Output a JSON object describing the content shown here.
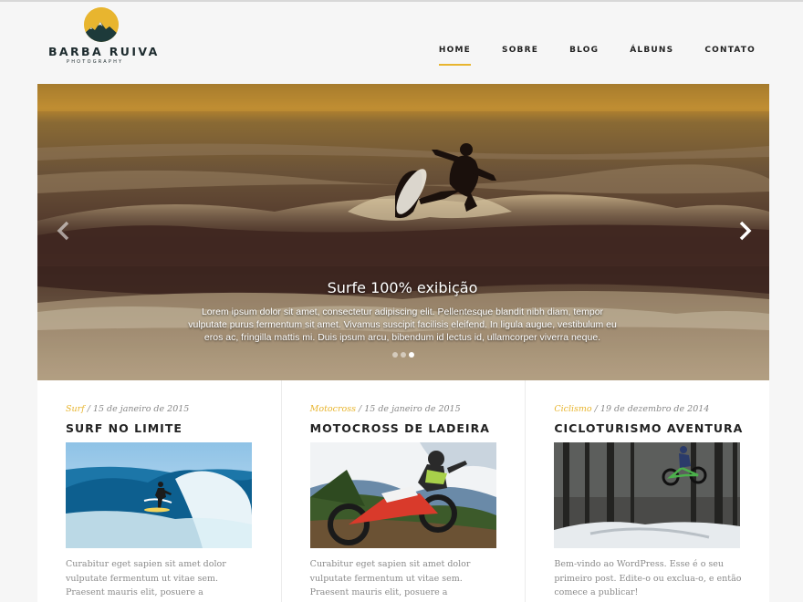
{
  "brand": {
    "name": "BARBA RUIVA",
    "tagline": "PHOTOGRAPHY",
    "accent": "#e8b52f"
  },
  "nav": {
    "items": [
      {
        "label": "HOME",
        "active": true
      },
      {
        "label": "SOBRE",
        "active": false
      },
      {
        "label": "BLOG",
        "active": false
      },
      {
        "label": "ÁLBUNS",
        "active": false
      },
      {
        "label": "CONTATO",
        "active": false
      }
    ]
  },
  "slider": {
    "title": "Surfe 100% exibição",
    "text": "Lorem ipsum dolor sit amet, consectetur adipiscing elit. Pellentesque blandit nibh diam, tempor vulputate purus fermentum sit amet. Vivamus suscipit facilisis eleifend. In ligula augue, vestibulum eu eros ac, fringilla mattis mi. Duis ipsum arcu, bibendum id lectus id, ullamcorper viverra neque.",
    "prev_icon": "chevron-left-icon",
    "next_icon": "chevron-right-icon",
    "slide_count": 3,
    "active_slide": 3
  },
  "posts": [
    {
      "category": "Surf",
      "date": " / 15 de janeiro de 2015",
      "title": "SURF NO LIMITE",
      "excerpt": "Curabitur eget sapien sit amet dolor vulputate fermentum ut vitae sem. Praesent mauris elit, posuere a ullamcorper non, varius quis ipsum."
    },
    {
      "category": "Motocross",
      "date": " / 15 de janeiro de 2015",
      "title": "MOTOCROSS DE LADEIRA",
      "excerpt": "Curabitur eget sapien sit amet dolor vulputate fermentum ut vitae sem. Praesent mauris elit, posuere a ullamcorper non, varius quis ipsum."
    },
    {
      "category": "Ciclismo",
      "date": " / 19 de dezembro de 2014",
      "title": "CICLOTURISMO AVENTURA",
      "excerpt": "Bem-vindo ao WordPress. Esse é o seu primeiro post. Edite-o ou exclua-o, e então comece a publicar!"
    }
  ]
}
